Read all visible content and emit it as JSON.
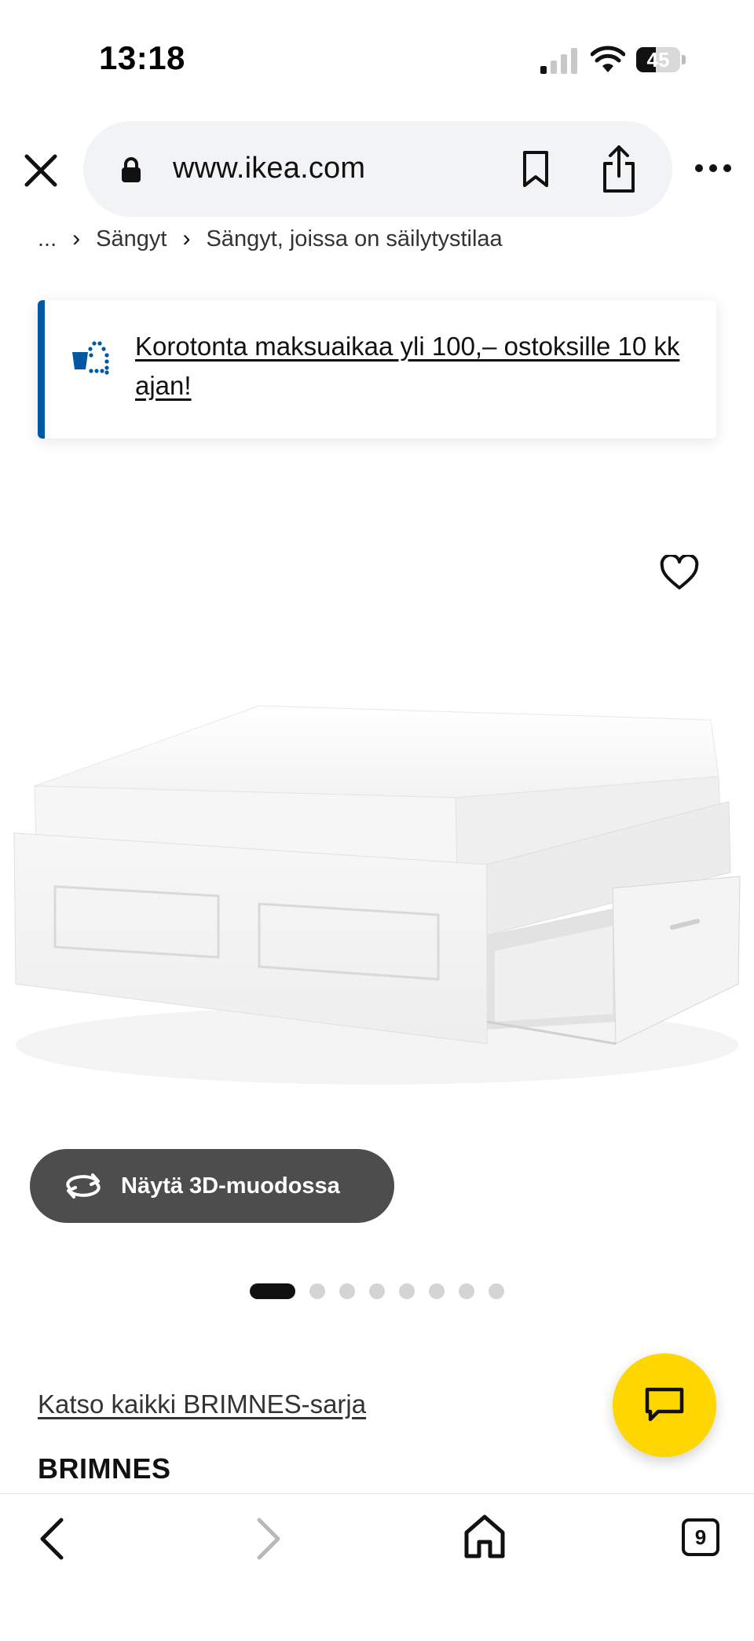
{
  "status_bar": {
    "time": "13:18",
    "battery_level": "45"
  },
  "browser": {
    "url": "www.ikea.com"
  },
  "breadcrumb": {
    "items": [
      "...",
      "Sängyt",
      "Sängyt, joissa on säilytystilaa"
    ]
  },
  "promo": {
    "text": "Korotonta maksuaikaa yli 100,– ostoksille 10 kk ajan!",
    "accent_color": "#0058a3"
  },
  "product": {
    "view_3d_label": "Näytä 3D-muodossa",
    "image_count": 8,
    "active_image": 1,
    "series_link": "Katso kaikki BRIMNES-sarja",
    "name": "BRIMNES"
  },
  "chat": {
    "color": "#ffd600"
  },
  "toolbar": {
    "tab_count": "9"
  }
}
